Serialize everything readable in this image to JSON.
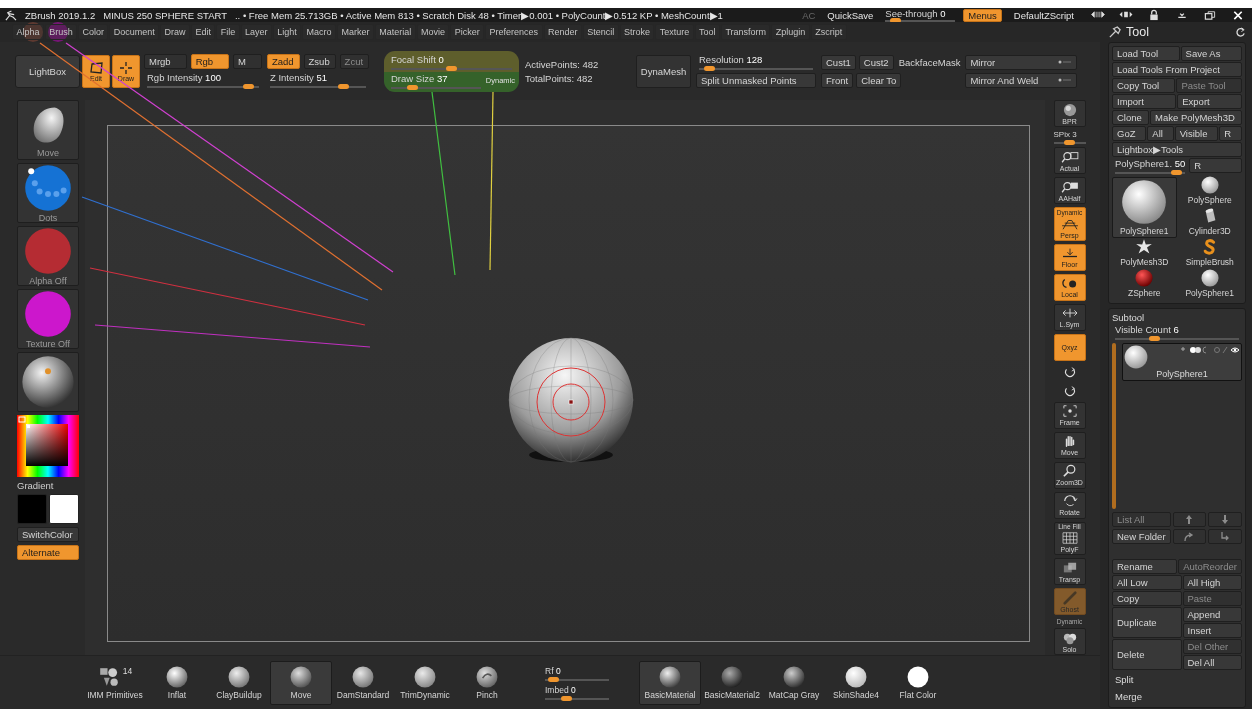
{
  "title_bar": {
    "title": "ZBrush 2019.1.2",
    "document": "MINUS 250 SPHERE START",
    "stats": ".. • Free Mem 25.713GB • Active Mem 813 • Scratch Disk 48 • Timer▶0.001 • PolyCount▶0.512 KP • MeshCount▶1",
    "controls": [
      {
        "kind": "text",
        "label": "AC",
        "disabled": true
      },
      {
        "kind": "button",
        "label": "QuickSave",
        "disabled": false
      },
      {
        "kind": "slider",
        "label": "See-through",
        "value": "0",
        "level": 0.08
      },
      {
        "kind": "toggle",
        "label": "Menus",
        "on": true
      },
      {
        "kind": "button",
        "label": "DefaultZScript",
        "disabled": false
      }
    ]
  },
  "menu_bar": [
    "Alpha",
    "Brush",
    "Color",
    "Document",
    "Draw",
    "Edit",
    "File",
    "Layer",
    "Light",
    "Macro",
    "Marker",
    "Material",
    "Movie",
    "Picker",
    "Preferences",
    "Render",
    "Stencil",
    "Stroke",
    "Texture",
    "Tool",
    "Transform",
    "Zplugin",
    "Zscript"
  ],
  "top_shelf": {
    "lightbox": "LightBox",
    "modes": [
      {
        "kind": "edit",
        "label": "Edit",
        "on": true
      },
      {
        "kind": "draw",
        "label": "Draw",
        "on": true
      }
    ],
    "channels": [
      {
        "label": "Mrgb",
        "on": false,
        "disabled": false
      },
      {
        "label": "Rgb",
        "on": true,
        "disabled": false
      },
      {
        "label": "M",
        "on": false,
        "disabled": false
      }
    ],
    "rgb_intensity": {
      "label": "Rgb Intensity",
      "value": "100",
      "level": 0.95
    },
    "depth_modes": [
      {
        "label": "Zadd",
        "on": true,
        "disabled": false
      },
      {
        "label": "Zsub",
        "on": false,
        "disabled": false
      },
      {
        "label": "Zcut",
        "on": false,
        "disabled": true
      }
    ],
    "z_intensity": {
      "label": "Z Intensity",
      "value": "51",
      "level": 0.8
    },
    "focal_shift": {
      "label": "Focal Shift",
      "value": "0",
      "level": 0.5
    },
    "draw_size": {
      "label": "Draw Size",
      "value": "37",
      "level": 0.2
    },
    "dynamic": "Dynamic",
    "points": [
      "ActivePoints: 482",
      "TotalPoints: 482"
    ],
    "dynamesh": "DynaMesh",
    "resolution": {
      "label": "Resolution",
      "value": "128",
      "level": 0.05
    },
    "split_unmasked": "Split Unmasked Points",
    "options": [
      {
        "kind": "button",
        "label": "Cust1"
      },
      {
        "kind": "button",
        "label": "Cust2"
      },
      {
        "kind": "plain",
        "label": "BackfaceMask"
      },
      {
        "kind": "button",
        "label": "Front"
      },
      {
        "kind": "button",
        "label": "Clear To"
      }
    ],
    "mirror": [
      "Mirror",
      "Mirror And Weld"
    ]
  },
  "left_shelf": {
    "thumbs": [
      {
        "kind": "brush",
        "label": "Move"
      },
      {
        "kind": "stroke",
        "label": "Dots"
      },
      {
        "kind": "alpha",
        "label": "Alpha Off"
      },
      {
        "kind": "texture",
        "label": "Texture Off"
      },
      {
        "kind": "material"
      }
    ],
    "gradient": "Gradient",
    "swatches": [
      {
        "color": "#000000"
      },
      {
        "color": "#ffffff"
      }
    ],
    "switch_color": "SwitchColor",
    "alternate": {
      "label": "Alternate",
      "on": true
    }
  },
  "right_shelf": [
    {
      "kind": "bpr",
      "label": "BPR",
      "on": false
    },
    {
      "kind": "slider",
      "label": "SPix 3",
      "level": 0.5
    },
    {
      "kind": "actual",
      "label": "Actual",
      "on": false
    },
    {
      "kind": "aahalf",
      "label": "AAHalf",
      "on": false
    },
    {
      "kind": "persp",
      "label": "Persp",
      "caption": "Dynamic",
      "on": true
    },
    {
      "kind": "floor",
      "label": "Floor",
      "on": true
    },
    {
      "kind": "local",
      "label": "Local",
      "on": true
    },
    {
      "kind": "lsym",
      "label": "L.Sym",
      "on": false
    },
    {
      "kind": "qxyz",
      "label": "Qxyz",
      "on": true
    },
    {
      "kind": "qy",
      "on": false
    },
    {
      "kind": "qz",
      "on": false
    },
    {
      "kind": "frame",
      "label": "Frame",
      "on": false
    },
    {
      "kind": "move",
      "label": "Move",
      "on": false
    },
    {
      "kind": "zoom",
      "label": "Zoom3D",
      "on": false
    },
    {
      "kind": "rotate",
      "label": "Rotate",
      "on": false
    },
    {
      "kind": "polyf",
      "label": "PolyF",
      "caption": "Line Fill",
      "on": false
    },
    {
      "kind": "transp",
      "label": "Transp",
      "on": false
    },
    {
      "kind": "ghost",
      "label": "Ghost",
      "on": true,
      "disabled": true
    },
    {
      "kind": "caption",
      "label": "Dynamic"
    },
    {
      "kind": "solo",
      "label": "Solo",
      "on": false
    }
  ],
  "tool_panel": {
    "title": "Tool",
    "rows": [
      [
        {
          "label": "Load Tool",
          "disabled": false
        },
        {
          "label": "Save As",
          "disabled": false
        }
      ],
      [
        {
          "label": "Load Tools From Project",
          "disabled": false
        }
      ],
      [
        {
          "label": "Copy Tool",
          "disabled": false
        },
        {
          "label": "Paste Tool",
          "disabled": true
        }
      ],
      [
        {
          "label": "Import",
          "disabled": false
        },
        {
          "label": "Export",
          "disabled": false
        }
      ],
      [
        {
          "label": "Clone",
          "disabled": false
        },
        {
          "label": "Make PolyMesh3D",
          "disabled": false
        }
      ],
      [
        {
          "label": "GoZ",
          "disabled": false
        },
        {
          "label": "All",
          "disabled": false
        },
        {
          "label": "Visible",
          "disabled": false
        },
        {
          "label": "R",
          "disabled": false
        }
      ],
      [
        {
          "label": "Lightbox▶Tools",
          "disabled": false
        }
      ]
    ],
    "tool_slider": {
      "label": "PolySphere1.",
      "value": "50",
      "level": 0.95
    },
    "tool_slider_reset": "R",
    "current_tool": {
      "kind": "polysphere",
      "label": "PolySphere1",
      "selected": true
    },
    "tools": [
      {
        "kind": "sphere",
        "label": "PolySphere",
        "selected": false
      },
      {
        "kind": "cylinder",
        "label": "Cylinder3D",
        "selected": false
      },
      {
        "kind": "star",
        "label": "PolyMesh3D",
        "selected": false
      },
      {
        "kind": "simplebrush",
        "label": "SimpleBrush",
        "selected": false
      },
      {
        "kind": "zsphere",
        "label": "ZSphere",
        "selected": false
      },
      {
        "kind": "sphere",
        "label": "PolySphere1",
        "selected": false
      }
    ]
  },
  "subtool": {
    "title": "Subtool",
    "visible_count": {
      "label": "Visible Count",
      "value": "6",
      "level": 0.3
    },
    "items": [
      {
        "label": "PolySphere1",
        "selected": true
      }
    ],
    "list_buttons": [
      {
        "label": "List All",
        "disabled": true
      },
      {
        "kind": "up",
        "disabled": true
      },
      {
        "kind": "down",
        "disabled": true
      },
      {
        "label": "New Folder",
        "disabled": false
      },
      {
        "kind": "redo",
        "disabled": true
      },
      {
        "kind": "insert",
        "disabled": true
      }
    ],
    "actions": [
      {
        "main": {
          "label": "Rename",
          "disabled": false
        },
        "side": [
          {
            "label": "AutoReorder",
            "disabled": true
          }
        ]
      },
      {
        "main": {
          "label": "All Low",
          "disabled": false
        },
        "side": [
          {
            "label": "All High",
            "disabled": false
          }
        ]
      },
      {
        "main": {
          "label": "Copy",
          "disabled": false
        },
        "side": [
          {
            "label": "Paste",
            "disabled": true
          }
        ]
      },
      {
        "main": {
          "label": "Duplicate",
          "disabled": false
        },
        "side": [
          {
            "label": "Append",
            "disabled": false
          },
          {
            "label": "Insert",
            "disabled": false
          }
        ]
      },
      {
        "main": {
          "label": "Delete",
          "disabled": false
        },
        "side": [
          {
            "label": "Del Other",
            "disabled": true
          },
          {
            "label": "Del All",
            "disabled": false
          }
        ]
      }
    ],
    "sections": [
      "Split",
      "Merge"
    ]
  },
  "bottom_shelf": {
    "brushes": [
      {
        "kind": "imm",
        "label": "IMM Primitives",
        "count": "14",
        "selected": false
      },
      {
        "kind": "inflat",
        "label": "Inflat",
        "selected": false
      },
      {
        "kind": "clay",
        "label": "ClayBuildup",
        "selected": false
      },
      {
        "kind": "move",
        "label": "Move",
        "selected": true
      },
      {
        "kind": "dam",
        "label": "DamStandard",
        "selected": false
      },
      {
        "kind": "trim",
        "label": "TrimDynamic",
        "selected": false
      },
      {
        "kind": "pinch",
        "label": "Pinch",
        "selected": false
      }
    ],
    "sliders": [
      {
        "label": "Rf",
        "value": "0",
        "level": 0.05
      },
      {
        "label": "Imbed",
        "value": "0",
        "level": 0.3
      }
    ],
    "materials": [
      {
        "kind": "basic",
        "label": "BasicMaterial",
        "selected": true
      },
      {
        "kind": "basic2",
        "label": "BasicMaterial2",
        "selected": false
      },
      {
        "kind": "matcap",
        "label": "MatCap Gray",
        "selected": false
      },
      {
        "kind": "skin",
        "label": "SkinShade4",
        "selected": false
      },
      {
        "kind": "flat",
        "label": "Flat Color",
        "selected": false
      }
    ]
  }
}
